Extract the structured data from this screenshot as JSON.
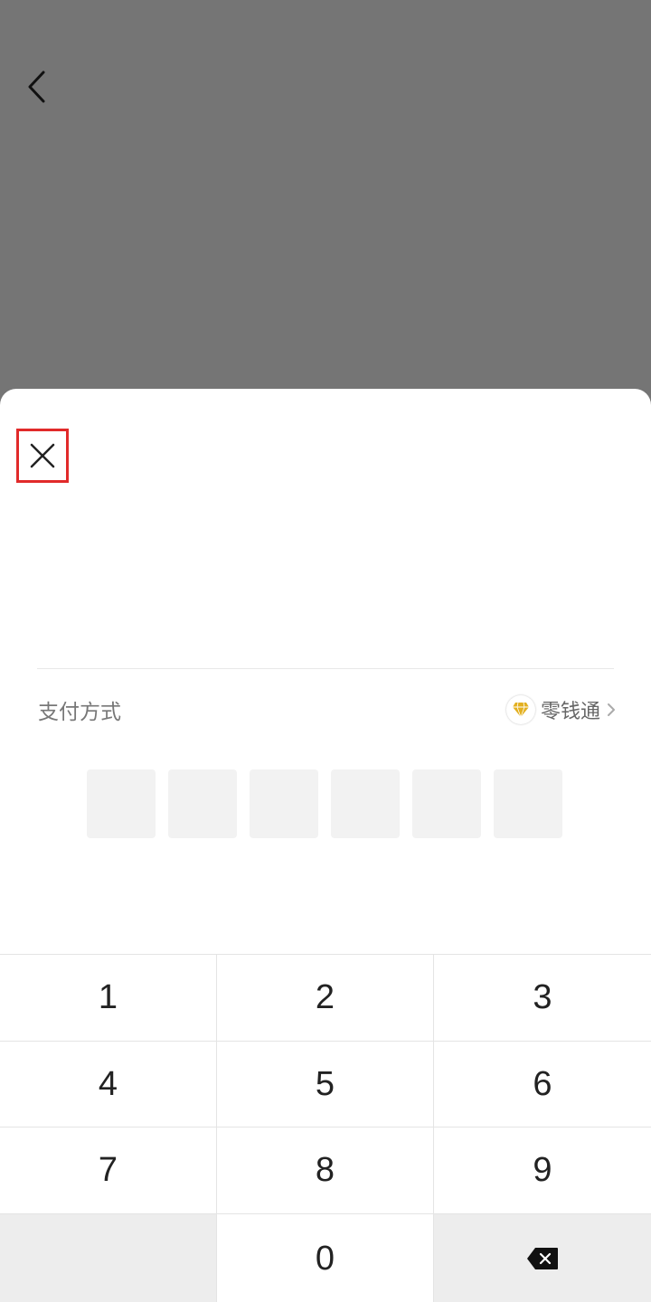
{
  "header": {
    "back_icon": "chevron-left-icon"
  },
  "sheet": {
    "close_icon": "close-icon",
    "payment": {
      "label": "支付方式",
      "method_icon": "diamond-icon",
      "method_icon_color": "#e3b020",
      "method_name": "零钱通",
      "chevron_icon": "chevron-right-icon"
    },
    "pin_length": 6,
    "keypad": {
      "keys": [
        "1",
        "2",
        "3",
        "4",
        "5",
        "6",
        "7",
        "8",
        "9",
        "",
        "0",
        "⌫"
      ],
      "delete_icon": "backspace-icon"
    }
  },
  "colors": {
    "overlay": "#757575",
    "highlight_border": "#e12a2a",
    "pin_box": "#f2f2f2",
    "key_gray": "#ededed"
  }
}
